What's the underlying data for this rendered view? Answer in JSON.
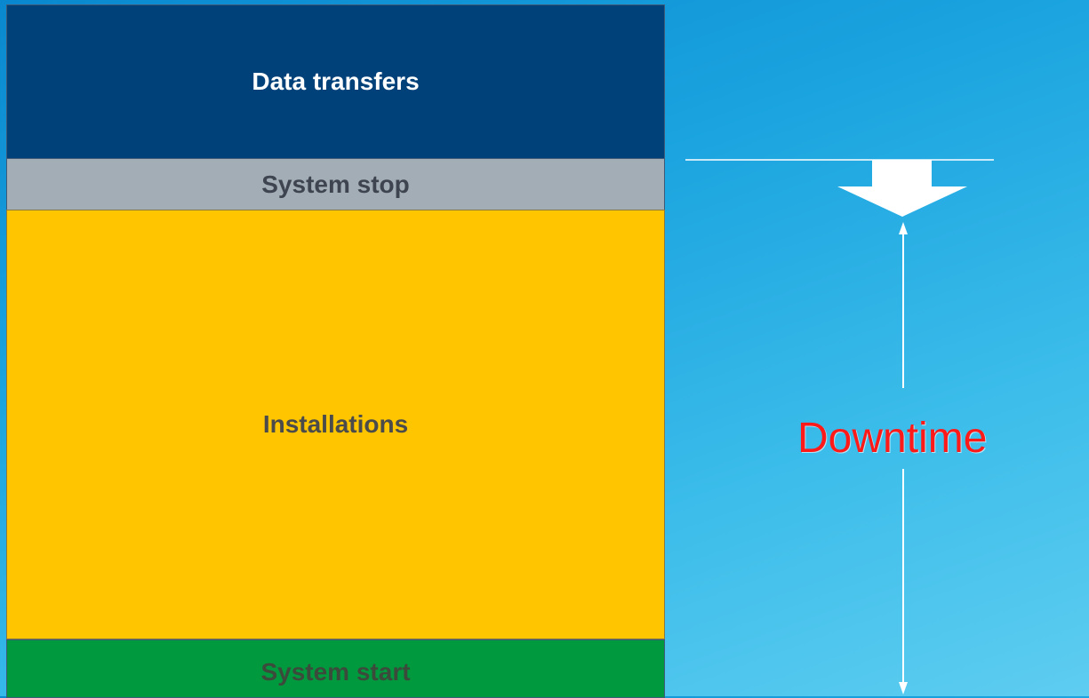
{
  "blocks": {
    "data_transfers": "Data transfers",
    "system_stop": "System stop",
    "installations": "Installations",
    "system_start": "System start"
  },
  "annotation": {
    "downtime": "Downtime"
  },
  "colors": {
    "data_transfers": "#00417a",
    "system_stop": "#a3adb6",
    "installations": "#ffc600",
    "system_start": "#00993d",
    "downtime_text": "#ff1a1a",
    "background": "#1aa3df"
  }
}
